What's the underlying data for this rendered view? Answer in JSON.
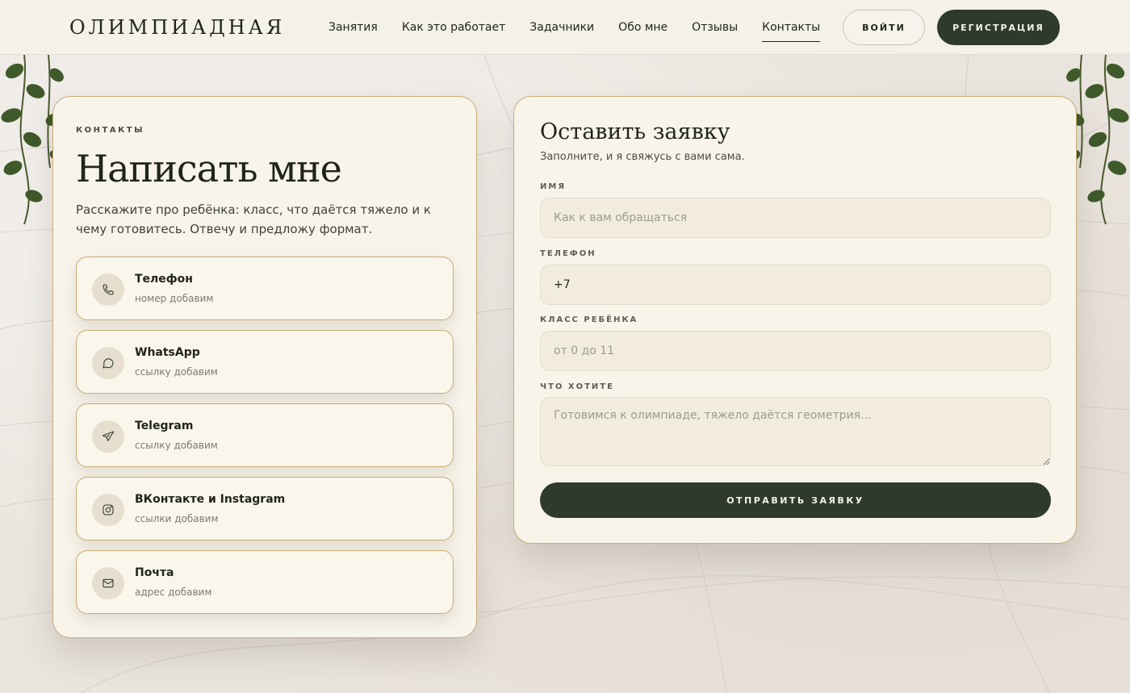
{
  "header": {
    "logo": "ОЛИМПИАДНАЯ",
    "nav": [
      {
        "label": "Занятия"
      },
      {
        "label": "Как это работает"
      },
      {
        "label": "Задачники"
      },
      {
        "label": "Обо мне"
      },
      {
        "label": "Отзывы"
      },
      {
        "label": "Контакты",
        "active": true
      }
    ],
    "login_label": "ВОЙТИ",
    "register_label": "РЕГИСТРАЦИЯ"
  },
  "contacts": {
    "eyebrow": "КОНТАКТЫ",
    "title": "Написать мне",
    "description": "Расскажите про ребёнка: класс, что даётся тяжело и к чему готовитесь. Отвечу и предложу формат.",
    "items": [
      {
        "icon": "phone-icon",
        "name": "Телефон",
        "value": "номер добавим"
      },
      {
        "icon": "chat-bubble-icon",
        "name": "WhatsApp",
        "value": "ссылку добавим"
      },
      {
        "icon": "paper-plane-icon",
        "name": "Telegram",
        "value": "ссылку добавим"
      },
      {
        "icon": "instagram-icon",
        "name": "ВКонтакте и Instagram",
        "value": "ссылки добавим"
      },
      {
        "icon": "mail-icon",
        "name": "Почта",
        "value": "адрес добавим"
      }
    ]
  },
  "form": {
    "title": "Оставить заявку",
    "subtitle": "Заполните, и я свяжусь с вами сама.",
    "name_label": "ИМЯ",
    "name_placeholder": "Как к вам обращаться",
    "phone_label": "ТЕЛЕФОН",
    "phone_value": "+7",
    "grade_label": "КЛАСС РЕБЁНКА",
    "grade_placeholder": "от 0 до 11",
    "wish_label": "ЧТО ХОТИТЕ",
    "wish_placeholder": "Готовимся к олимпиаде, тяжело даётся геометрия...",
    "submit_label": "ОТПРАВИТЬ ЗАЯВКУ"
  },
  "colors": {
    "accent_dark": "#2e3a2b",
    "card_border": "#c8ab74",
    "card_bg": "#f8f4ea"
  }
}
